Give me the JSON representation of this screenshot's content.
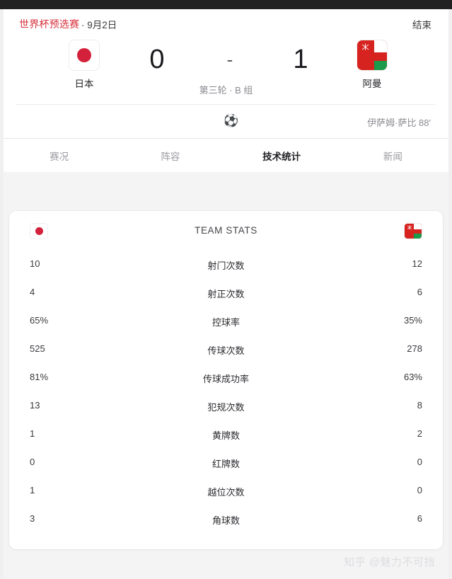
{
  "statusbar": {
    "color": "#222222"
  },
  "match": {
    "competition": "世界杯预选赛",
    "competition_color": "#d8303a",
    "date": "· 9月2日",
    "status": "结束",
    "round": "第三轮 · B 组",
    "home": {
      "name": "日本",
      "score": "0",
      "flag": "japan-flag"
    },
    "away": {
      "name": "阿曼",
      "score": "1",
      "flag": "oman-flag"
    },
    "dash": "-",
    "goal": {
      "icon": "soccer-ball-icon",
      "glyph": "⚽",
      "scorer": "伊萨姆·萨比 88'"
    }
  },
  "tabs": [
    {
      "label": "赛况",
      "active": false
    },
    {
      "label": "阵容",
      "active": false
    },
    {
      "label": "技术统计",
      "active": true
    },
    {
      "label": "新闻",
      "active": false
    }
  ],
  "stats": {
    "title": "TEAM STATS",
    "home_flag": "japan-flag",
    "away_flag": "oman-flag",
    "rows": [
      {
        "label": "射门次数",
        "home": "10",
        "away": "12"
      },
      {
        "label": "射正次数",
        "home": "4",
        "away": "6"
      },
      {
        "label": "控球率",
        "home": "65%",
        "away": "35%"
      },
      {
        "label": "传球次数",
        "home": "525",
        "away": "278"
      },
      {
        "label": "传球成功率",
        "home": "81%",
        "away": "63%"
      },
      {
        "label": "犯规次数",
        "home": "13",
        "away": "8"
      },
      {
        "label": "黄牌数",
        "home": "1",
        "away": "2"
      },
      {
        "label": "红牌数",
        "home": "0",
        "away": "0"
      },
      {
        "label": "越位次数",
        "home": "1",
        "away": "0"
      },
      {
        "label": "角球数",
        "home": "3",
        "away": "6"
      }
    ]
  },
  "watermark": "知乎 @魅力不可挡"
}
